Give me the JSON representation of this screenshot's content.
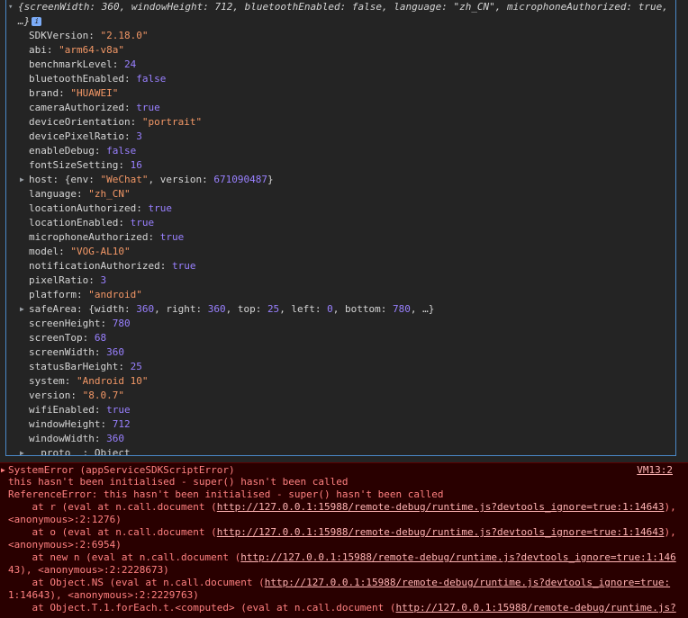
{
  "summary": {
    "text": "{screenWidth: 360, windowHeight: 712, bluetoothEnabled: false, language: \"zh_CN\", microphoneAuthorized: true, …}",
    "badge": "i"
  },
  "properties": [
    {
      "key": "SDKVersion",
      "value": "\"2.18.0\"",
      "type": "str"
    },
    {
      "key": "abi",
      "value": "\"arm64-v8a\"",
      "type": "str"
    },
    {
      "key": "benchmarkLevel",
      "value": "24",
      "type": "num"
    },
    {
      "key": "bluetoothEnabled",
      "value": "false",
      "type": "bool"
    },
    {
      "key": "brand",
      "value": "\"HUAWEI\"",
      "type": "str"
    },
    {
      "key": "cameraAuthorized",
      "value": "true",
      "type": "bool"
    },
    {
      "key": "deviceOrientation",
      "value": "\"portrait\"",
      "type": "str"
    },
    {
      "key": "devicePixelRatio",
      "value": "3",
      "type": "num"
    },
    {
      "key": "enableDebug",
      "value": "false",
      "type": "bool"
    },
    {
      "key": "fontSizeSetting",
      "value": "16",
      "type": "num"
    },
    {
      "key": "host",
      "value": "{env: \"WeChat\", version: 671090487}",
      "type": "obj",
      "expandable": true
    },
    {
      "key": "language",
      "value": "\"zh_CN\"",
      "type": "str"
    },
    {
      "key": "locationAuthorized",
      "value": "true",
      "type": "bool"
    },
    {
      "key": "locationEnabled",
      "value": "true",
      "type": "bool"
    },
    {
      "key": "microphoneAuthorized",
      "value": "true",
      "type": "bool"
    },
    {
      "key": "model",
      "value": "\"VOG-AL10\"",
      "type": "str"
    },
    {
      "key": "notificationAuthorized",
      "value": "true",
      "type": "bool"
    },
    {
      "key": "pixelRatio",
      "value": "3",
      "type": "num"
    },
    {
      "key": "platform",
      "value": "\"android\"",
      "type": "str"
    },
    {
      "key": "safeArea",
      "value": "{width: 360, right: 360, top: 25, left: 0, bottom: 780, …}",
      "type": "obj",
      "expandable": true
    },
    {
      "key": "screenHeight",
      "value": "780",
      "type": "num"
    },
    {
      "key": "screenTop",
      "value": "68",
      "type": "num"
    },
    {
      "key": "screenWidth",
      "value": "360",
      "type": "num"
    },
    {
      "key": "statusBarHeight",
      "value": "25",
      "type": "num"
    },
    {
      "key": "system",
      "value": "\"Android 10\"",
      "type": "str"
    },
    {
      "key": "version",
      "value": "\"8.0.7\"",
      "type": "str"
    },
    {
      "key": "wifiEnabled",
      "value": "true",
      "type": "bool"
    },
    {
      "key": "windowHeight",
      "value": "712",
      "type": "num"
    },
    {
      "key": "windowWidth",
      "value": "360",
      "type": "num"
    },
    {
      "key": "__proto__",
      "value": "Object",
      "type": "proto",
      "expandable": true
    }
  ],
  "error": {
    "header": "SystemError (appServiceSDKScriptError)",
    "source": "VM13:2",
    "message": "this hasn't been initialised - super() hasn't been called",
    "reference": "ReferenceError: this hasn't been initialised - super() hasn't been called",
    "stack": [
      {
        "prefix": "at r (eval at n.call.document (",
        "url": "http://127.0.0.1:15988/remote-debug/runtime.js?devtools_ignore=true:1:14643",
        "suffix": "),",
        "cont": "<anonymous>:2:1276)"
      },
      {
        "prefix": "at o (eval at n.call.document (",
        "url": "http://127.0.0.1:15988/remote-debug/runtime.js?devtools_ignore=true:1:14643",
        "suffix": "),",
        "cont": "<anonymous>:2:6954)"
      },
      {
        "prefix": "at new n (eval at n.call.document (",
        "url": "http://127.0.0.1:15988/remote-debug/runtime.js?devtools_ignore=true:1:146",
        "suffix": "",
        "cont": "43), <anonymous>:2:2228673)"
      },
      {
        "prefix": "at Object.NS (eval at n.call.document (",
        "url": "http://127.0.0.1:15988/remote-debug/runtime.js?devtools_ignore=true:",
        "suffix": "",
        "cont": "1:14643), <anonymous>:2:2229763)"
      },
      {
        "prefix": "at Object.T.1.forEach.t.<computed> (eval at n.call.document (",
        "url": "http://127.0.0.1:15988/remote-debug/runtime.js?",
        "suffix": "",
        "cont": ""
      }
    ]
  }
}
